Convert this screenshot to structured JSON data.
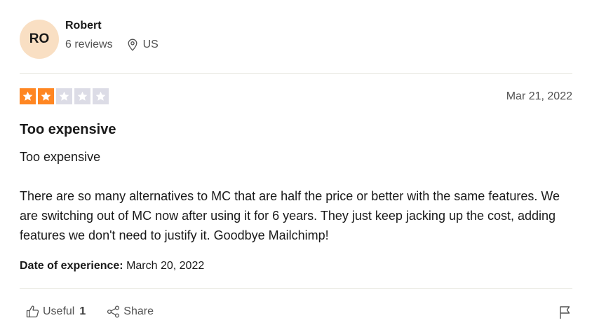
{
  "consumer": {
    "initials": "RO",
    "name": "Robert",
    "reviews": "6 reviews",
    "country": "US",
    "avatar_color": "#f9dfc3"
  },
  "review": {
    "rating": 2,
    "max_rating": 5,
    "star_color": "#ff8622",
    "empty_star_color": "#dcdce6",
    "date": "Mar 21, 2022",
    "title": "Too expensive",
    "body_line1": "Too expensive",
    "body_line2": "There are so many alternatives to MC that are half the price or better with the same features. We are switching out of MC now after using it for 6 years. They just keep jacking up the cost, adding features we don't need to justify it. Goodbye Mailchimp!",
    "experience_label": "Date of experience:",
    "experience_date": "March 20, 2022"
  },
  "actions": {
    "useful_label": "Useful",
    "useful_count": "1",
    "share_label": "Share",
    "icons": [
      "thumbs-up-icon",
      "share-icon",
      "flag-icon"
    ]
  }
}
